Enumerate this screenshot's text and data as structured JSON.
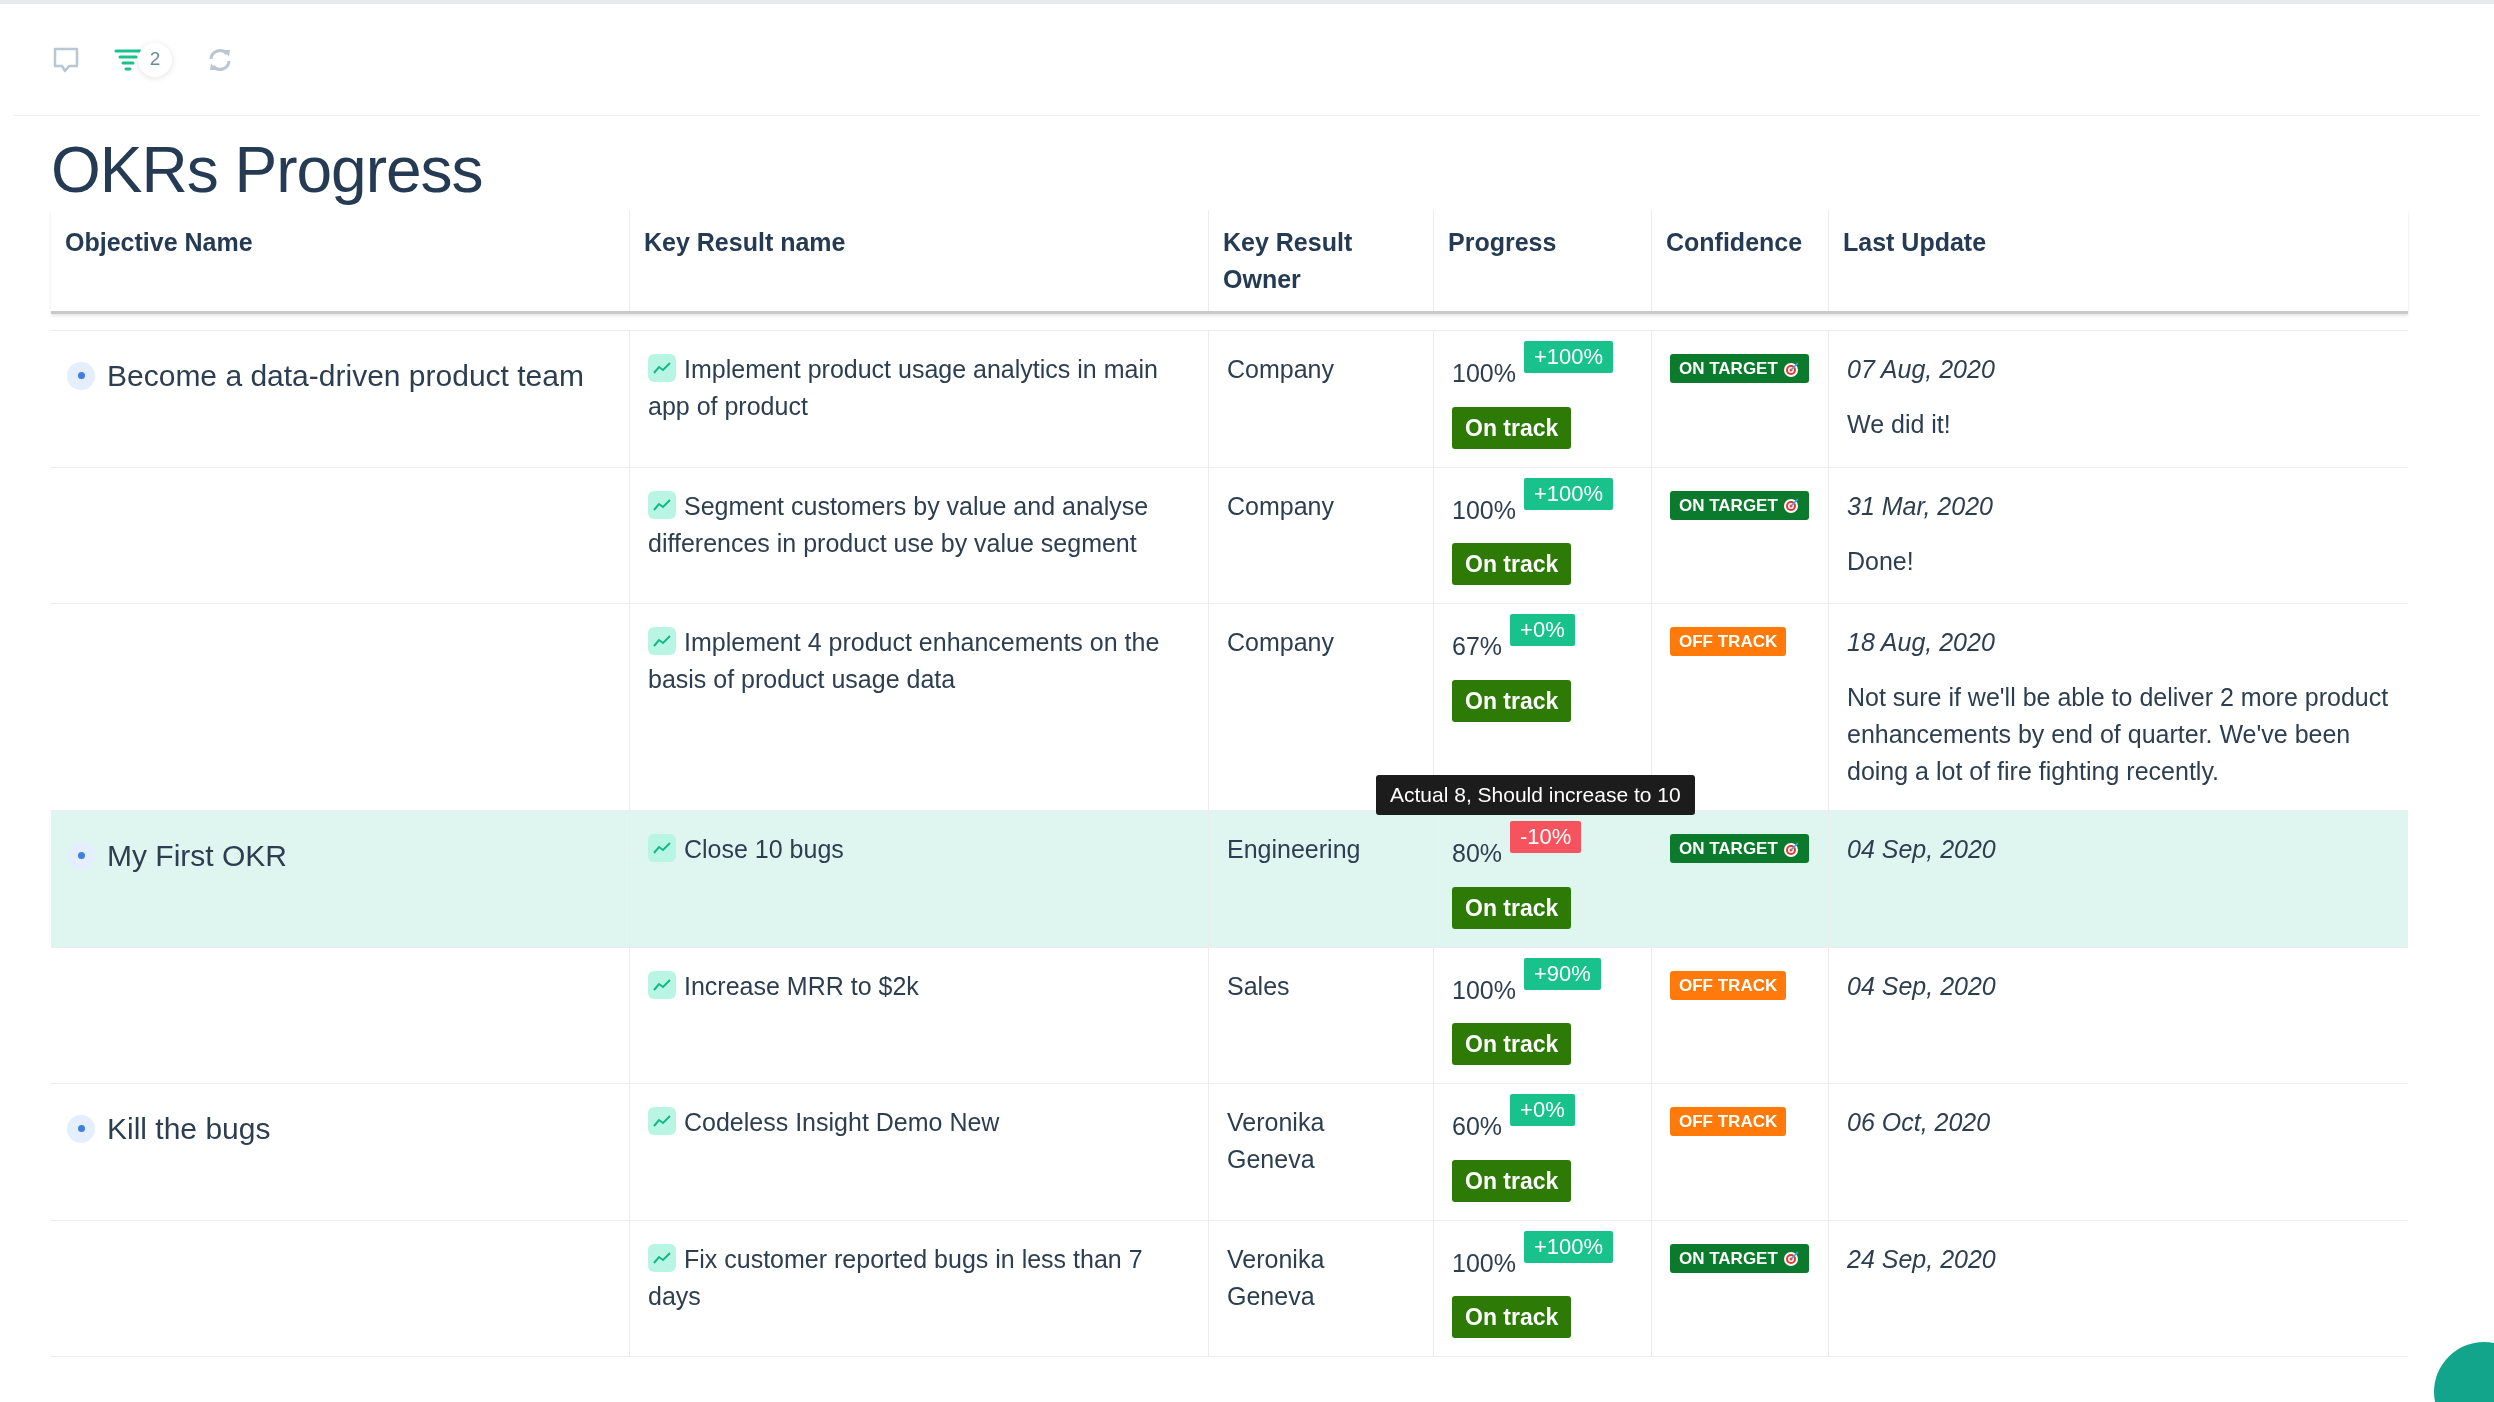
{
  "toolbar": {
    "filter_count": "2"
  },
  "title": "OKRs Progress",
  "table": {
    "columns": [
      "Objective Name",
      "Key Result name",
      "Key Result Owner",
      "Progress",
      "Confidence",
      "Last Update"
    ],
    "objectives": [
      {
        "name": "Become a data-driven product team",
        "key_results": [
          {
            "name": "Implement product usage analytics in main app of product",
            "selected": false,
            "owner": "Company",
            "progress": "100%",
            "delta": {
              "text": "+100%",
              "kind": "up"
            },
            "status": "On track",
            "confidence": {
              "text": "ON TARGET",
              "kind": "on_target"
            },
            "date": "07 Aug, 2020",
            "comment": "We did it!"
          },
          {
            "name": "Segment customers by value and analyse differences in product use by value segment",
            "selected": false,
            "owner": "Company",
            "progress": "100%",
            "delta": {
              "text": "+100%",
              "kind": "up"
            },
            "status": "On track",
            "confidence": {
              "text": "ON TARGET",
              "kind": "on_target"
            },
            "date": "31 Mar, 2020",
            "comment": "Done!"
          },
          {
            "name": "Implement 4 product enhancements on the basis of product usage data",
            "selected": false,
            "owner": "Company",
            "progress": "67%",
            "delta": {
              "text": "+0%",
              "kind": "up"
            },
            "status": "On track",
            "confidence": {
              "text": "OFF TRACK",
              "kind": "off_track"
            },
            "date": "18 Aug, 2020",
            "comment": "Not sure if we'll be able to deliver 2 more product enhancements by end of quarter. We've been doing a lot of fire fighting recently."
          }
        ]
      },
      {
        "name": "My First OKR",
        "key_results": [
          {
            "name": "Close 10 bugs",
            "selected": true,
            "owner": "Engineering",
            "progress": "80%",
            "delta": {
              "text": "-10%",
              "kind": "down"
            },
            "tooltip": "Actual 8, Should increase to 10",
            "status": "On track",
            "confidence": {
              "text": "ON TARGET",
              "kind": "on_target"
            },
            "date": "04 Sep, 2020"
          },
          {
            "name": "Increase MRR to $2k",
            "selected": false,
            "owner": "Sales",
            "progress": "100%",
            "delta": {
              "text": "+90%",
              "kind": "up"
            },
            "status": "On track",
            "confidence": {
              "text": "OFF TRACK",
              "kind": "off_track"
            },
            "date": "04 Sep, 2020"
          }
        ]
      },
      {
        "name": "Kill the bugs",
        "key_results": [
          {
            "name": "Codeless Insight Demo New",
            "selected": false,
            "owner": "Veronika Geneva",
            "progress": "60%",
            "delta": {
              "text": "+0%",
              "kind": "up"
            },
            "status": "On track",
            "confidence": {
              "text": "OFF TRACK",
              "kind": "off_track"
            },
            "date": "06 Oct, 2020"
          },
          {
            "name": "Fix customer reported bugs in less than 7 days",
            "selected": false,
            "owner": "Veronika Geneva",
            "progress": "100%",
            "delta": {
              "text": "+100%",
              "kind": "up"
            },
            "status": "On track",
            "confidence": {
              "text": "ON TARGET",
              "kind": "on_target"
            },
            "date": "24 Sep, 2020"
          }
        ]
      }
    ]
  }
}
